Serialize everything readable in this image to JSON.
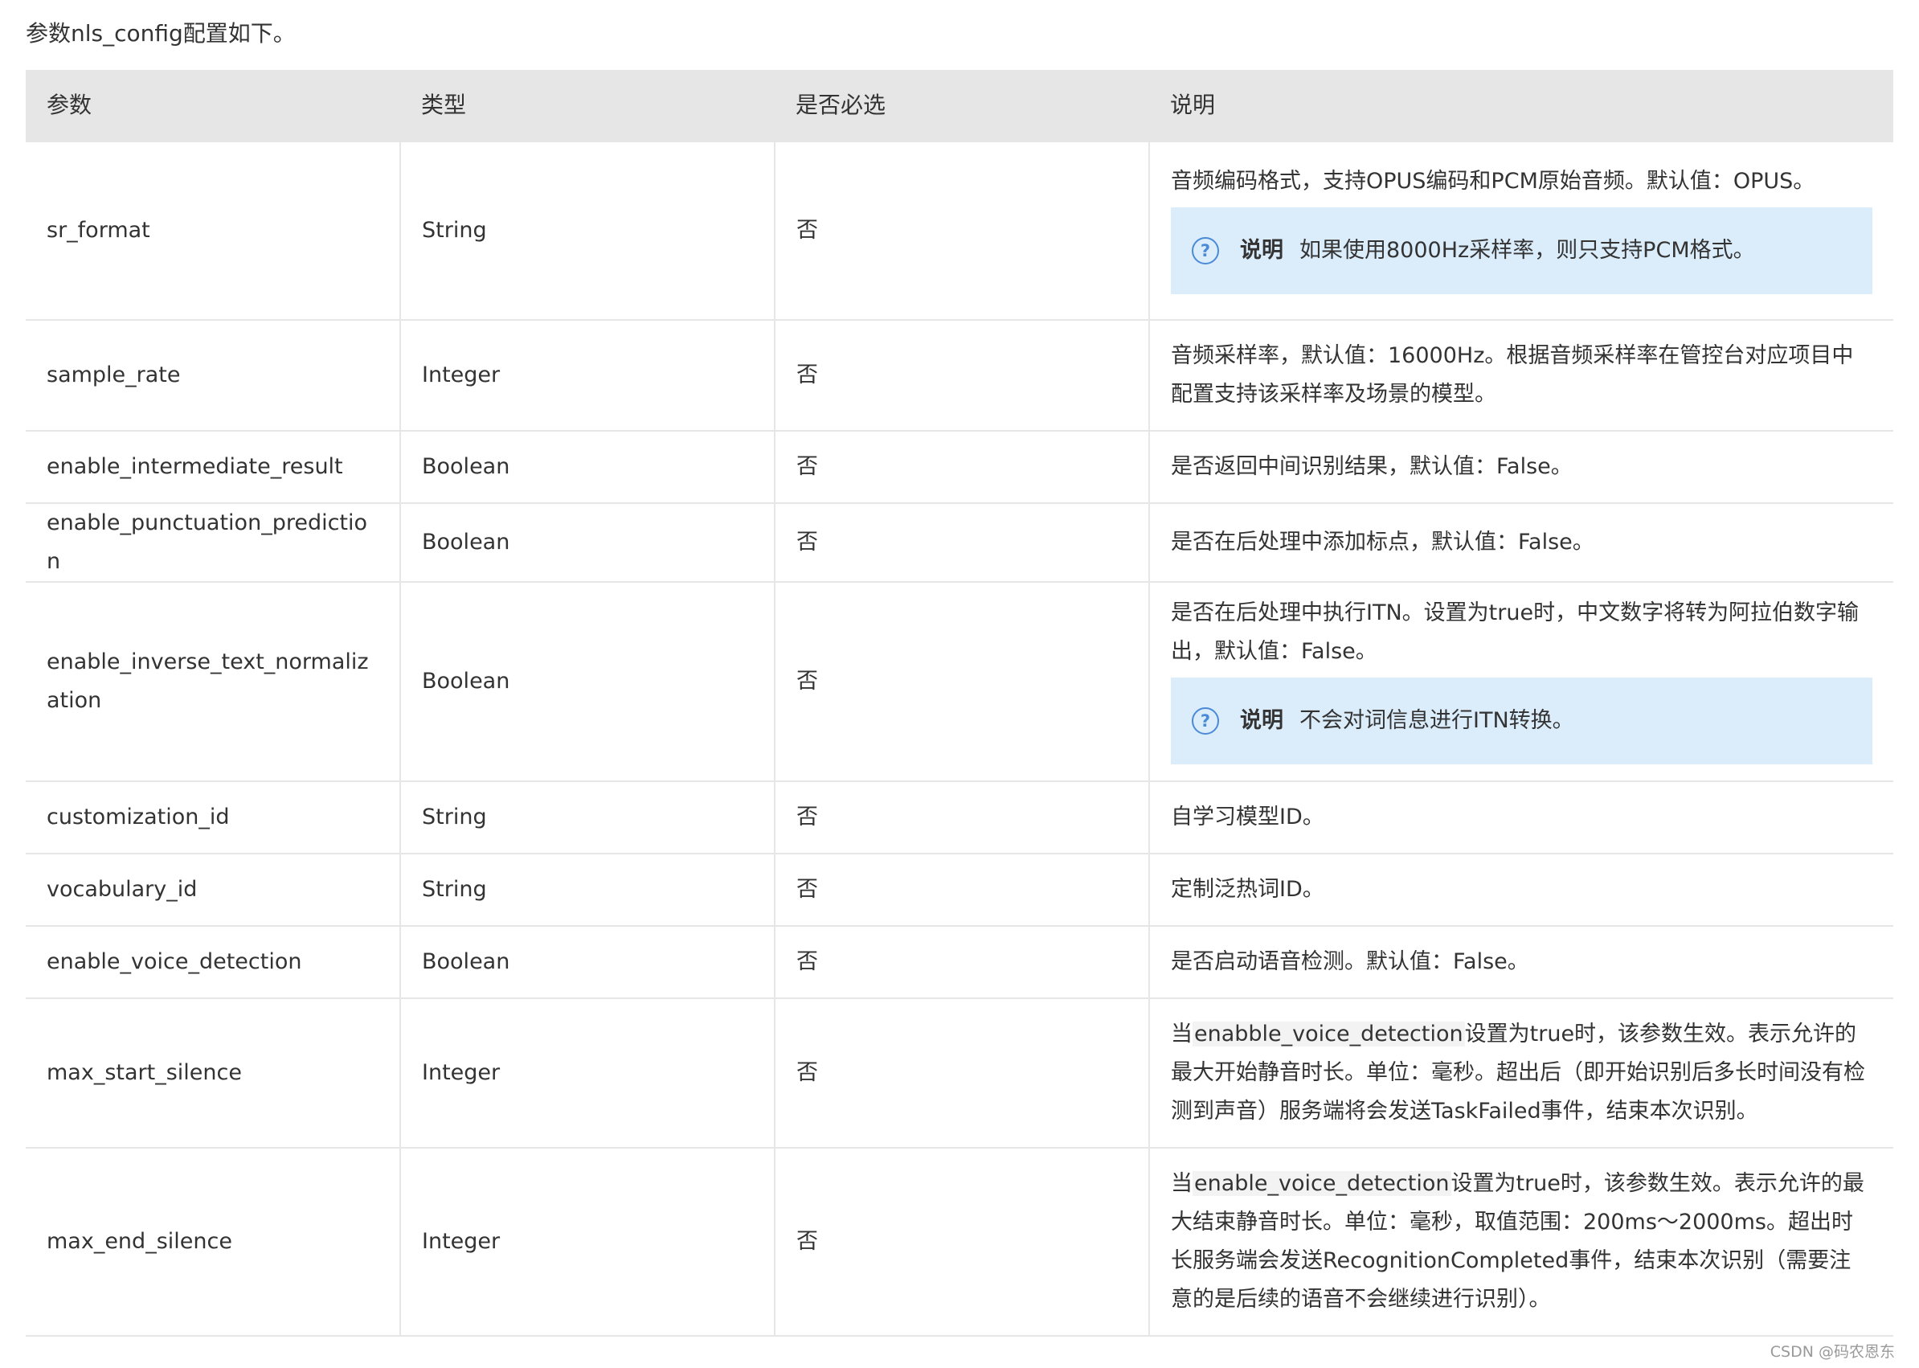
{
  "intro": "参数nls_config配置如下。",
  "table": {
    "headers": [
      "参数",
      "类型",
      "是否必选",
      "说明"
    ],
    "rows": [
      {
        "name": "sr_format",
        "type": "String",
        "required": "否",
        "desc": "音频编码格式，支持OPUS编码和PCM原始音频。默认值：OPUS。",
        "note_title": "说明",
        "note": "如果使用8000Hz采样率，则只支持PCM格式。"
      },
      {
        "name": "sample_rate",
        "type": "Integer",
        "required": "否",
        "desc": "音频采样率，默认值：16000Hz。根据音频采样率在管控台对应项目中配置支持该采样率及场景的模型。"
      },
      {
        "name": "enable_intermediate_result",
        "type": "Boolean",
        "required": "否",
        "desc": "是否返回中间识别结果，默认值：False。"
      },
      {
        "name": "enable_punctuation_prediction",
        "type": "Boolean",
        "required": "否",
        "desc": "是否在后处理中添加标点，默认值：False。"
      },
      {
        "name": "enable_inverse_text_normalization",
        "type": "Boolean",
        "required": "否",
        "desc": "是否在后处理中执行ITN。设置为true时，中文数字将转为阿拉伯数字输出，默认值：False。",
        "note_title": "说明",
        "note": "不会对词信息进行ITN转换。"
      },
      {
        "name": "customization_id",
        "type": "String",
        "required": "否",
        "desc": "自学习模型ID。"
      },
      {
        "name": "vocabulary_id",
        "type": "String",
        "required": "否",
        "desc": "定制泛热词ID。"
      },
      {
        "name": "enable_voice_detection",
        "type": "Boolean",
        "required": "否",
        "desc": "是否启动语音检测。默认值：False。"
      },
      {
        "name": "max_start_silence",
        "type": "Integer",
        "required": "否",
        "desc_pre": "当",
        "desc_code": "enabble_voice_detection",
        "desc_post": "设置为true时，该参数生效。表示允许的最大开始静音时长。单位：毫秒。超出后（即开始识别后多长时间没有检测到声音）服务端将会发送TaskFailed事件，结束本次识别。"
      },
      {
        "name": "max_end_silence",
        "type": "Integer",
        "required": "否",
        "desc_pre": "当",
        "desc_code": "enable_voice_detection",
        "desc_post": "设置为true时，该参数生效。表示允许的最大结束静音时长。单位：毫秒，取值范围：200ms～2000ms。超出时长服务端会发送RecognitionCompleted事件，结束本次识别（需要注意的是后续的语音不会继续进行识别）。"
      }
    ]
  },
  "note_icon": "question-circle-icon",
  "watermark": "CSDN @码农恩东"
}
